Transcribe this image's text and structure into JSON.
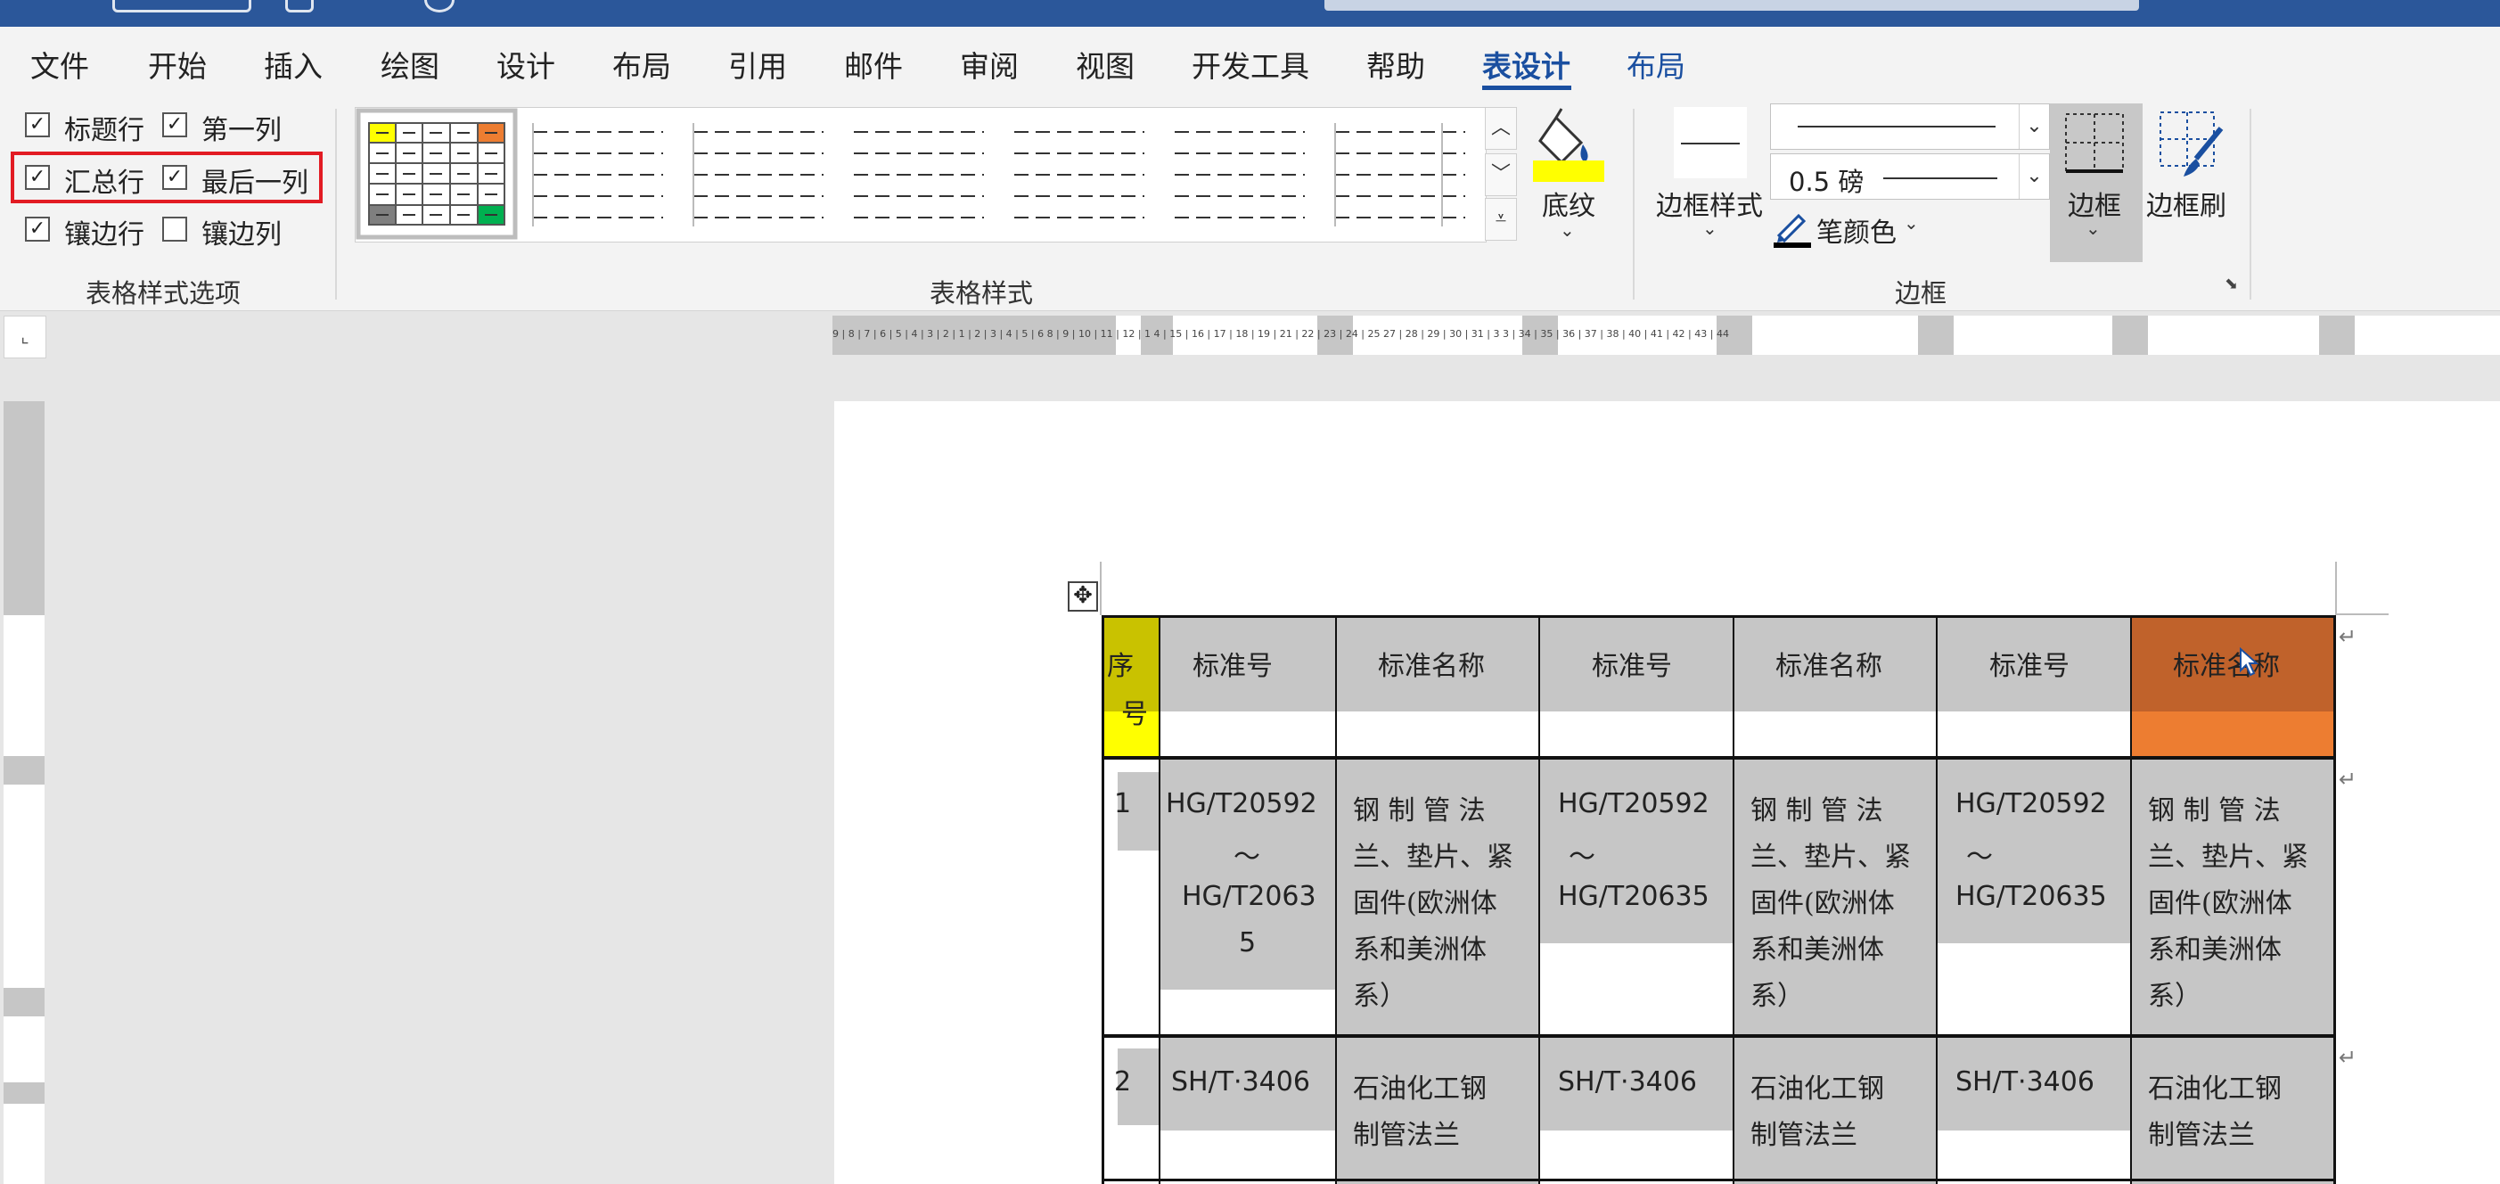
{
  "menu": {
    "items": [
      "文件",
      "开始",
      "插入",
      "绘图",
      "设计",
      "布局",
      "引用",
      "邮件",
      "审阅",
      "视图",
      "开发工具",
      "帮助",
      "表设计",
      "布局"
    ],
    "active_index": 12
  },
  "table_style_options": {
    "group_label": "表格样式选项",
    "options": [
      {
        "label": "标题行",
        "checked": true
      },
      {
        "label": "第一列",
        "checked": true
      },
      {
        "label": "汇总行",
        "checked": true
      },
      {
        "label": "最后一列",
        "checked": true
      },
      {
        "label": "镶边行",
        "checked": true
      },
      {
        "label": "镶边列",
        "checked": false
      }
    ]
  },
  "table_styles": {
    "group_label": "表格样式",
    "shading_label": "底纹",
    "shading_color": "#ffff00"
  },
  "borders": {
    "group_label": "边框",
    "border_styles_label": "边框样式",
    "line_weight": "0.5 磅",
    "pen_color_label": "笔颜色",
    "borders_label": "边框",
    "border_painter_label": "边框刷"
  },
  "ruler": {
    "h_labels": "9 | 8 | 7 | 6 | 5 | 4 | 3 | 2 | 1     |      2 | 3 | 4 | 5 | 6      8 | 9 | 10 | 11 | 12 | 1     4 | 15 | 16 | 17 | 18 | 19     | 21 | 22 | 23 | 24 | 25     27 | 28 | 29 | 30 | 31 | 3   3 | 34 | 35 | 36 | 37 | 38      | 40 | 41 | 42 | 43 | 44"
  },
  "table": {
    "header": {
      "seq_chars": [
        "序",
        "号"
      ],
      "columns": [
        "标准号",
        "标准名称",
        "标准号",
        "标准名称",
        "标准号",
        "标准名称"
      ]
    },
    "rows": [
      {
        "seq": "1",
        "std_no_lines_col1": [
          "HG/T20592",
          "～",
          "HG/T2063",
          "5"
        ],
        "std_no_lines": [
          "HG/T20592",
          "～",
          "HG/T20635"
        ],
        "std_name_lines": [
          "钢 制 管 法",
          "兰、垫片、紧",
          "固件(欧洲体",
          "系和美洲体",
          "系）"
        ]
      },
      {
        "seq": "2",
        "std_no": "SH/T·3406",
        "std_name_lines": [
          "石油化工钢",
          "制管法兰"
        ]
      }
    ],
    "colors": {
      "first_col": "#c9c200",
      "first_col_light": "#ffff00",
      "last_col": "#c0622b",
      "last_col_light": "#ed7d31",
      "banded": "#c6c6c6"
    }
  }
}
